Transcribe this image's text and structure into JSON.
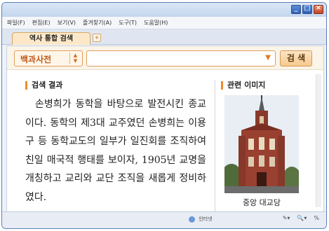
{
  "menu": [
    "파일(F)",
    "편집(E)",
    "보기(V)",
    "즐겨찾기(A)",
    "도구(T)",
    "도움말(H)"
  ],
  "tab": {
    "label": "역사 통합 검색",
    "add_label": "+"
  },
  "search": {
    "category": "백과사전",
    "query_value": "",
    "button_label": "검 색"
  },
  "results": {
    "title": "검색 결과",
    "text": "손병희가 동학을 바탕으로 발전시킨 종교이다. 동학의 제3대 교주였던 손병희는 이용구 등 동학교도의 일부가 일진회를 조직하여 친일 매국적 행태를 보이자, 1905년 교명을 개칭하고 교리와 교단 조직을 새롭게 정비하였다."
  },
  "images": {
    "title": "관련 이미지",
    "caption": "중앙 대교당"
  },
  "status": {
    "zone": "인터넷",
    "zoom": "%"
  },
  "colors": {
    "accent": "#f08a2a",
    "tab_bg": "#fce8c8",
    "window_border": "#5b7fb8"
  },
  "icons": [
    "minimize-icon",
    "maximize-icon",
    "close-icon",
    "spinner-icon",
    "dropdown-arrow-icon",
    "globe-icon"
  ]
}
